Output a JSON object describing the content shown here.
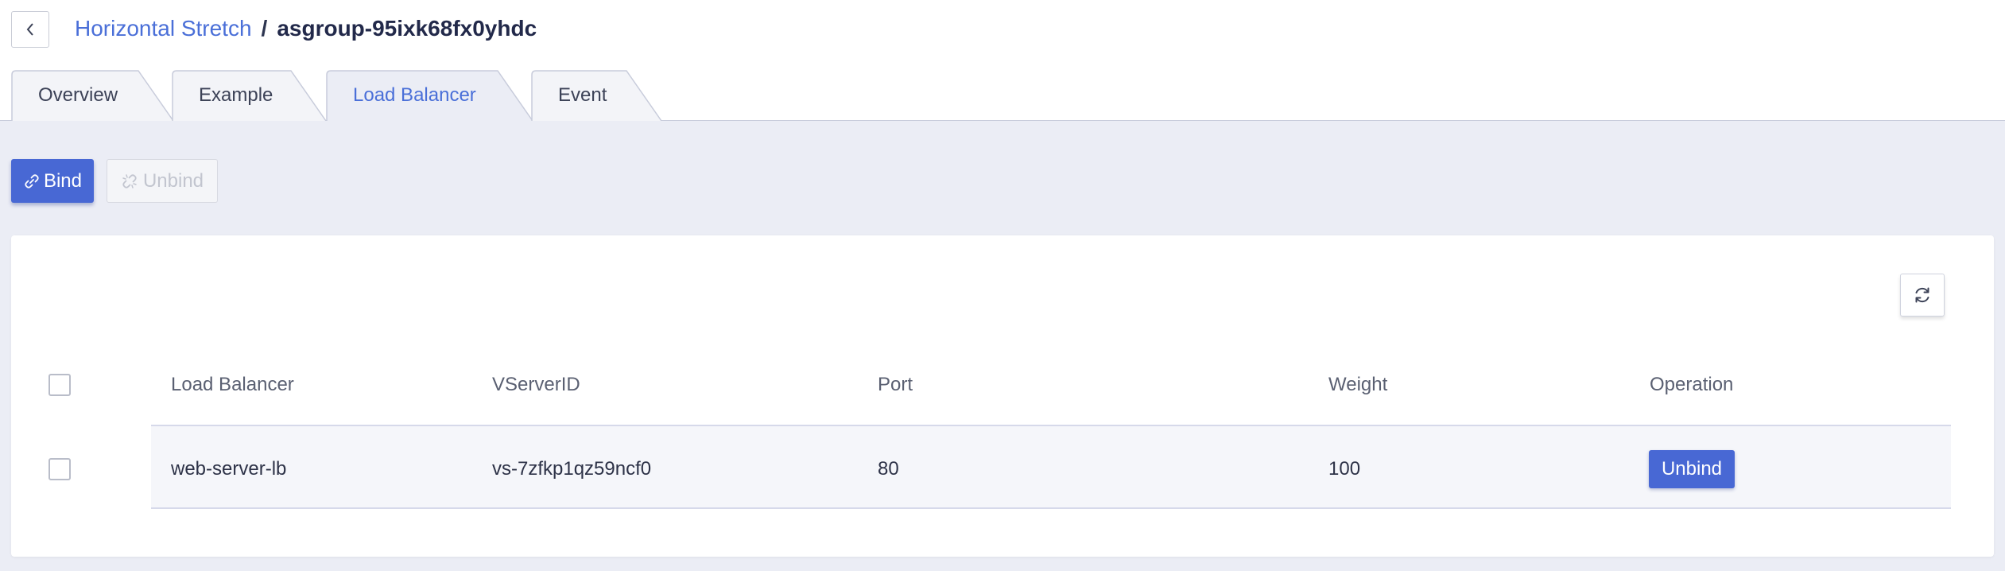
{
  "breadcrumb": {
    "parent": "Horizontal Stretch",
    "separator": "/",
    "current": "asgroup-95ixk68fx0yhdc"
  },
  "tabs": [
    {
      "label": "Overview",
      "active": false
    },
    {
      "label": "Example",
      "active": false
    },
    {
      "label": "Load Balancer",
      "active": true
    },
    {
      "label": "Event",
      "active": false
    }
  ],
  "toolbar": {
    "bind_label": "Bind",
    "unbind_label": "Unbind"
  },
  "table": {
    "columns": [
      "Load Balancer",
      "VServerID",
      "Port",
      "Weight",
      "Operation"
    ],
    "rows": [
      {
        "load_balancer": "web-server-lb",
        "vserver_id": "vs-7zfkp1qz59ncf0",
        "port": "80",
        "weight": "100",
        "operation": "Unbind"
      }
    ]
  },
  "icons": {
    "back": "chevron-left-icon",
    "bind": "link-icon",
    "unbind": "broken-link-icon",
    "refresh": "refresh-icon"
  },
  "colors": {
    "accent": "#4868d4",
    "link": "#4a6fd8",
    "background": "#ebedf5"
  }
}
